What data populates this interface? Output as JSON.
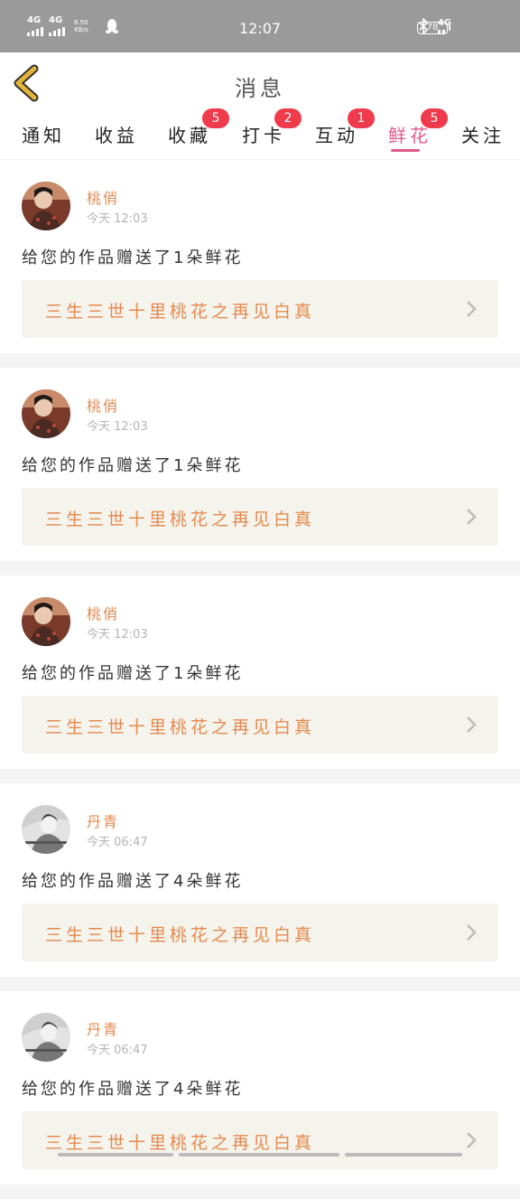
{
  "status_bar": {
    "net1": "4G",
    "net2": "4G",
    "speed_value": "8.50",
    "speed_unit": "KB/s",
    "time": "12:07",
    "net_right": "4G",
    "battery": "78"
  },
  "header": {
    "title": "消息",
    "back_icon": "chevron-left-icon"
  },
  "tabs": [
    {
      "label": "通知",
      "badge": ""
    },
    {
      "label": "收益",
      "badge": ""
    },
    {
      "label": "收藏",
      "badge": "5"
    },
    {
      "label": "打卡",
      "badge": "2"
    },
    {
      "label": "互动",
      "badge": "1"
    },
    {
      "label": "鲜花",
      "badge": "5",
      "active": true
    },
    {
      "label": "关注",
      "badge": ""
    }
  ],
  "messages": [
    {
      "user": "桃俏",
      "time": "今天 12:03",
      "text": "给您的作品赠送了1朵鲜花",
      "work": "三生三世十里桃花之再见白真"
    },
    {
      "user": "桃俏",
      "time": "今天 12:03",
      "text": "给您的作品赠送了1朵鲜花",
      "work": "三生三世十里桃花之再见白真"
    },
    {
      "user": "桃俏",
      "time": "今天 12:03",
      "text": "给您的作品赠送了1朵鲜花",
      "work": "三生三世十里桃花之再见白真"
    },
    {
      "user": "丹青",
      "time": "今天 06:47",
      "text": "给您的作品赠送了4朵鲜花",
      "work": "三生三世十里桃花之再见白真"
    },
    {
      "user": "丹青",
      "time": "今天 06:47",
      "text": "给您的作品赠送了4朵鲜花",
      "work": "三生三世十里桃花之再见白真"
    }
  ],
  "colors": {
    "accent": "#e15a86",
    "name": "#e6894e",
    "badge": "#ef3b4b",
    "back_icon": "#e3b53a"
  }
}
